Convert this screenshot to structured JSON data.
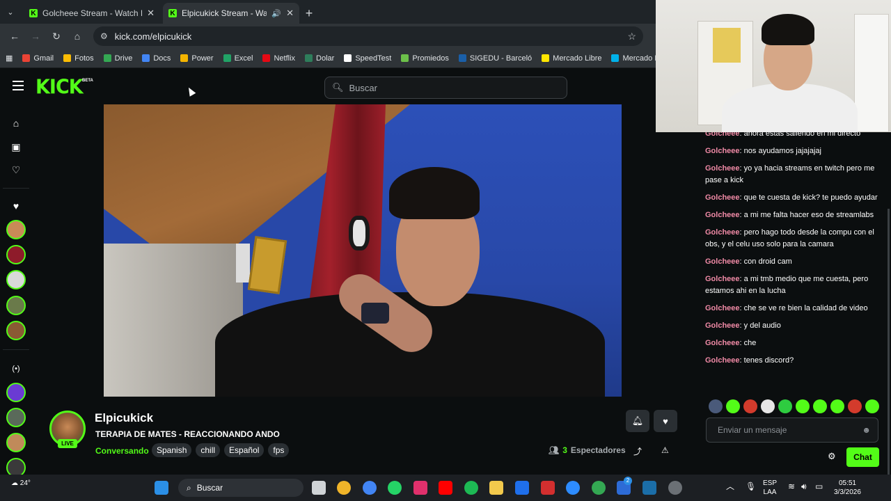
{
  "browser": {
    "tabs": [
      {
        "title": "Golcheee Stream - Watch Live on Kick",
        "active": false
      },
      {
        "title": "Elpicukick Stream - Watch Live on Kick",
        "active": true
      }
    ],
    "url": "kick.com/elpicukick",
    "bookmarks": [
      {
        "label": "Gmail",
        "color": "#ea4335"
      },
      {
        "label": "Fotos",
        "color": "#fbbc04"
      },
      {
        "label": "Drive",
        "color": "#34a853"
      },
      {
        "label": "Docs",
        "color": "#4285f4"
      },
      {
        "label": "Power",
        "color": "#f4b400"
      },
      {
        "label": "Excel",
        "color": "#21a366"
      },
      {
        "label": "Netflix",
        "color": "#e50914"
      },
      {
        "label": "Dolar",
        "color": "#2e7d5b"
      },
      {
        "label": "SpeedTest",
        "color": "#ffffff"
      },
      {
        "label": "Promiedos",
        "color": "#6cc04a"
      },
      {
        "label": "SIGEDU - Barceló",
        "color": "#1a5fa8"
      },
      {
        "label": "Mercado Libre",
        "color": "#ffe600"
      },
      {
        "label": "Mercado Pago",
        "color": "#00b1ea"
      }
    ]
  },
  "kick": {
    "logo": "KICK",
    "logo_badge": "BETA",
    "search_placeholder": "Buscar",
    "accent": "#53fc18"
  },
  "rail": {
    "icons": [
      "home-icon",
      "browse-icon",
      "following-icon",
      "heart-icon",
      "live-icon"
    ]
  },
  "channel": {
    "name": "Elpicukick",
    "live_badge": "LIVE",
    "title": "TERAPIA DE MATES - REACCIONANDO ANDO",
    "category": "Conversando",
    "tags": [
      "Spanish",
      "chill",
      "Español",
      "fps"
    ],
    "viewers_count": "3",
    "viewers_label": "Espectadores"
  },
  "chat": {
    "messages": [
      {
        "user": "Golcheee",
        "text": "ahora estas saliendo en mi directo"
      },
      {
        "user": "Golcheee",
        "text": "nos ayudamos jajajajaj"
      },
      {
        "user": "Golcheee",
        "text": "yo ya hacia streams en twitch pero me pase a kick"
      },
      {
        "user": "Golcheee",
        "text": "que te cuesta de kick? te puedo ayudar"
      },
      {
        "user": "Golcheee",
        "text": "a mi me falta hacer eso de streamlabs"
      },
      {
        "user": "Golcheee",
        "text": "pero hago todo desde la compu con el obs, y el celu uso solo para la camara"
      },
      {
        "user": "Golcheee",
        "text": "con droid cam"
      },
      {
        "user": "Golcheee",
        "text": "a mi tmb medio que me cuesta, pero estamos ahi en la lucha"
      },
      {
        "user": "Golcheee",
        "text": "che se ve re bien la calidad de video"
      },
      {
        "user": "Golcheee",
        "text": "y del audio"
      },
      {
        "user": "Golcheee",
        "text": "che"
      },
      {
        "user": "Golcheee",
        "text": "tenes discord?"
      }
    ],
    "input_placeholder": "Enviar un mensaje",
    "send_label": "Chat",
    "emote_colors": [
      "#4a5a7a",
      "#53fc18",
      "#d33b2c",
      "#e6e6e6",
      "#2ecc40",
      "#53fc18",
      "#53fc18",
      "#53fc18",
      "#d33b2c",
      "#53fc18"
    ]
  },
  "taskbar": {
    "temperature": "24°",
    "search_placeholder": "Buscar",
    "lang_top": "ESP",
    "lang_bottom": "LAA",
    "time": "05:51",
    "date": "3/3/2026",
    "badge_count": "2"
  }
}
